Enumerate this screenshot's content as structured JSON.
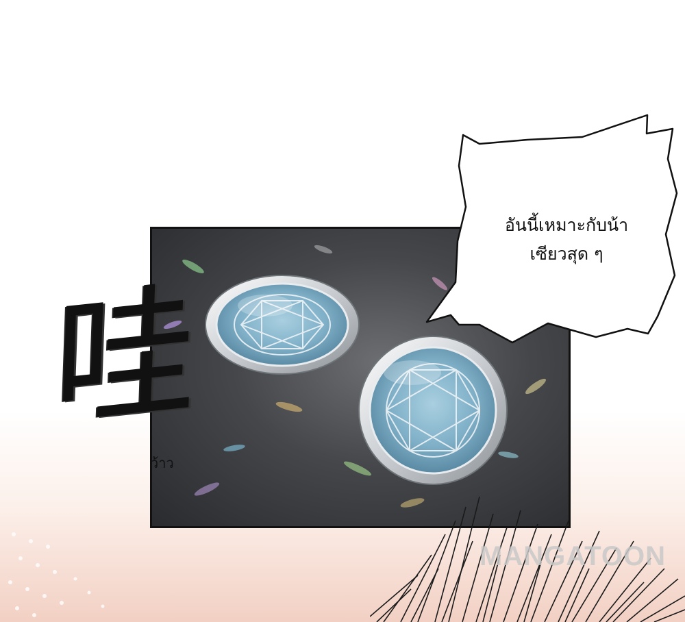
{
  "speech_bubble": {
    "line1": "อันนี้เหมาะกับน้า",
    "line2": "เซียวสุด ๆ"
  },
  "sound_effect": {
    "glyph": "哇",
    "translation": "ว้าว"
  },
  "watermark": {
    "text": "MANGATOON"
  },
  "colors": {
    "gem": "#7fb0c8",
    "ring": "#d9dcdf",
    "panel_bg": "#45474b"
  }
}
